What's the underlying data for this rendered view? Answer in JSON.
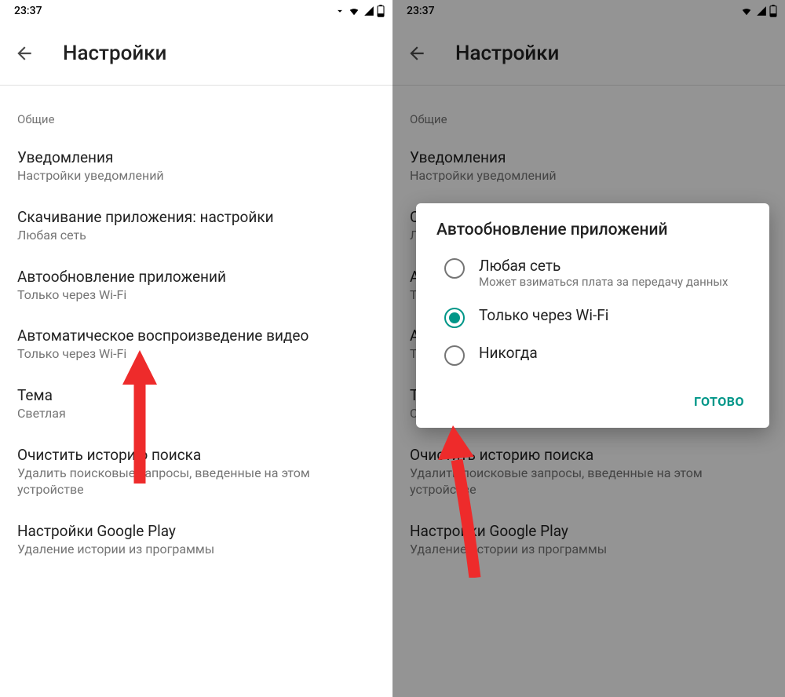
{
  "status": {
    "time": "23:37"
  },
  "appbar": {
    "title": "Настройки"
  },
  "section": {
    "header": "Общие"
  },
  "items": {
    "notifications": {
      "title": "Уведомления",
      "sub": "Настройки уведомлений"
    },
    "download": {
      "title": "Скачивание приложения: настройки",
      "sub": "Любая сеть"
    },
    "autoupdate": {
      "title": "Автообновление приложений",
      "sub": "Только через Wi-Fi"
    },
    "autoplay": {
      "title": "Автоматическое воспроизведение видео",
      "sub": "Только через Wi-Fi"
    },
    "theme": {
      "title": "Тема",
      "sub": "Светлая"
    },
    "clearhistory": {
      "title": "Очистить историю поиска",
      "sub": "Удалить поисковые запросы, введенные на этом устройстве"
    },
    "gplay": {
      "title": "Настройки Google Play",
      "sub": "Удаление истории из программы"
    }
  },
  "dialog": {
    "title": "Автообновление приложений",
    "options": {
      "any": {
        "label": "Любая сеть",
        "sub": "Может взиматься плата за передачу данных"
      },
      "wifi": {
        "label": "Только через Wi-Fi"
      },
      "never": {
        "label": "Никогда"
      }
    },
    "done": "ГОТОВО"
  },
  "colors": {
    "accent": "#009688",
    "arrow": "#ee2b2b"
  }
}
